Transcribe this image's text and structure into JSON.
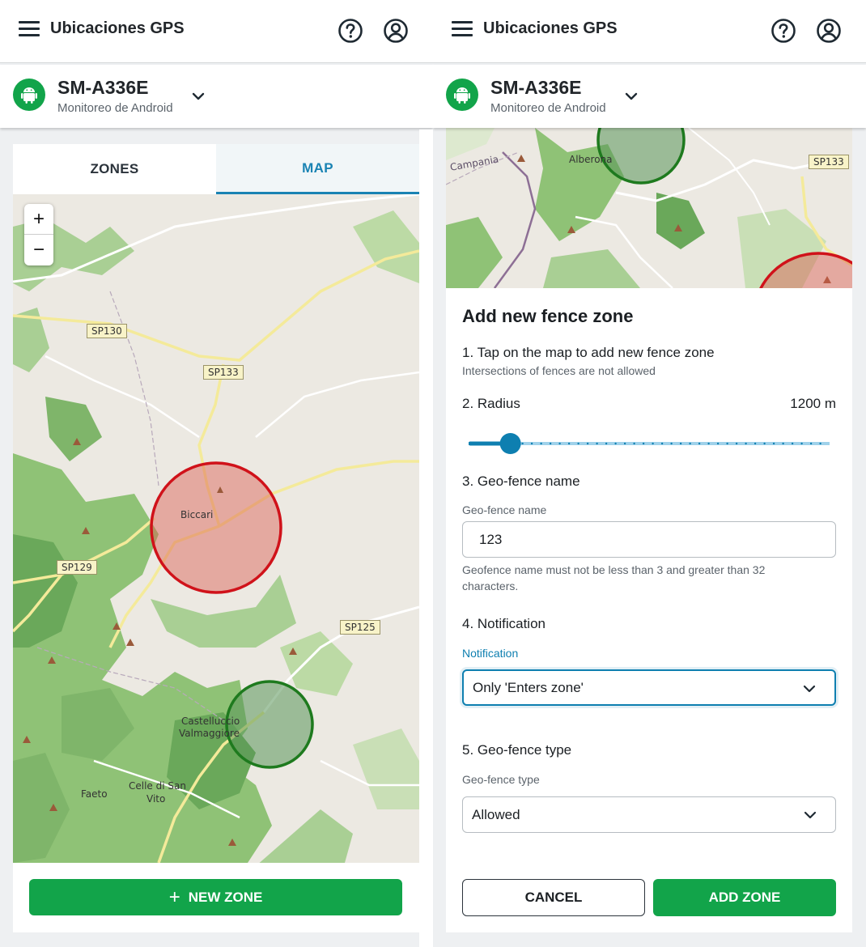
{
  "app": {
    "title": "Ubicaciones GPS",
    "device_name": "SM-A336E",
    "device_subtitle": "Monitoreo de Android"
  },
  "left": {
    "tabs": [
      {
        "label": "ZONES",
        "active": false
      },
      {
        "label": "MAP",
        "active": true
      }
    ],
    "zoom_in": "+",
    "zoom_out": "−",
    "map_labels": {
      "sp130": "SP130",
      "sp133": "SP133",
      "sp129": "SP129",
      "sp125": "SP125",
      "biccari": "Biccari",
      "castelluccio_1": "Castelluccio",
      "castelluccio_2": "Valmaggiore",
      "faeto": "Faeto",
      "celle_1": "Celle di San",
      "celle_2": "Vito"
    },
    "new_zone_icon": "+",
    "new_zone_label": "NEW ZONE"
  },
  "right": {
    "map_labels": {
      "campania": "Campania",
      "alberona": "Alberona",
      "sp133": "SP133"
    },
    "form": {
      "title": "Add new fence zone",
      "step1": "1. Tap on the map to add new fence zone",
      "step1_hint": "Intersections of fences are not allowed",
      "step2": "2. Radius",
      "radius_value": "1200 m",
      "radius_fraction": 0.09,
      "step3": "3. Geo-fence name",
      "name_label": "Geo-fence name",
      "name_value": "123",
      "name_hint": "Geofence name must not be less than 3 and greater than 32 characters.",
      "step4": "4. Notification",
      "notification_label": "Notification",
      "notification_value": "Only 'Enters zone'",
      "step5": "5. Geo-fence type",
      "type_label": "Geo-fence type",
      "type_value": "Allowed",
      "cancel_label": "CANCEL",
      "add_label": "ADD ZONE"
    }
  },
  "colors": {
    "brand_green": "#12a44a",
    "accent_blue": "#1a83b3",
    "zone_red": "#d0121a",
    "zone_green": "#1e7a1e"
  }
}
